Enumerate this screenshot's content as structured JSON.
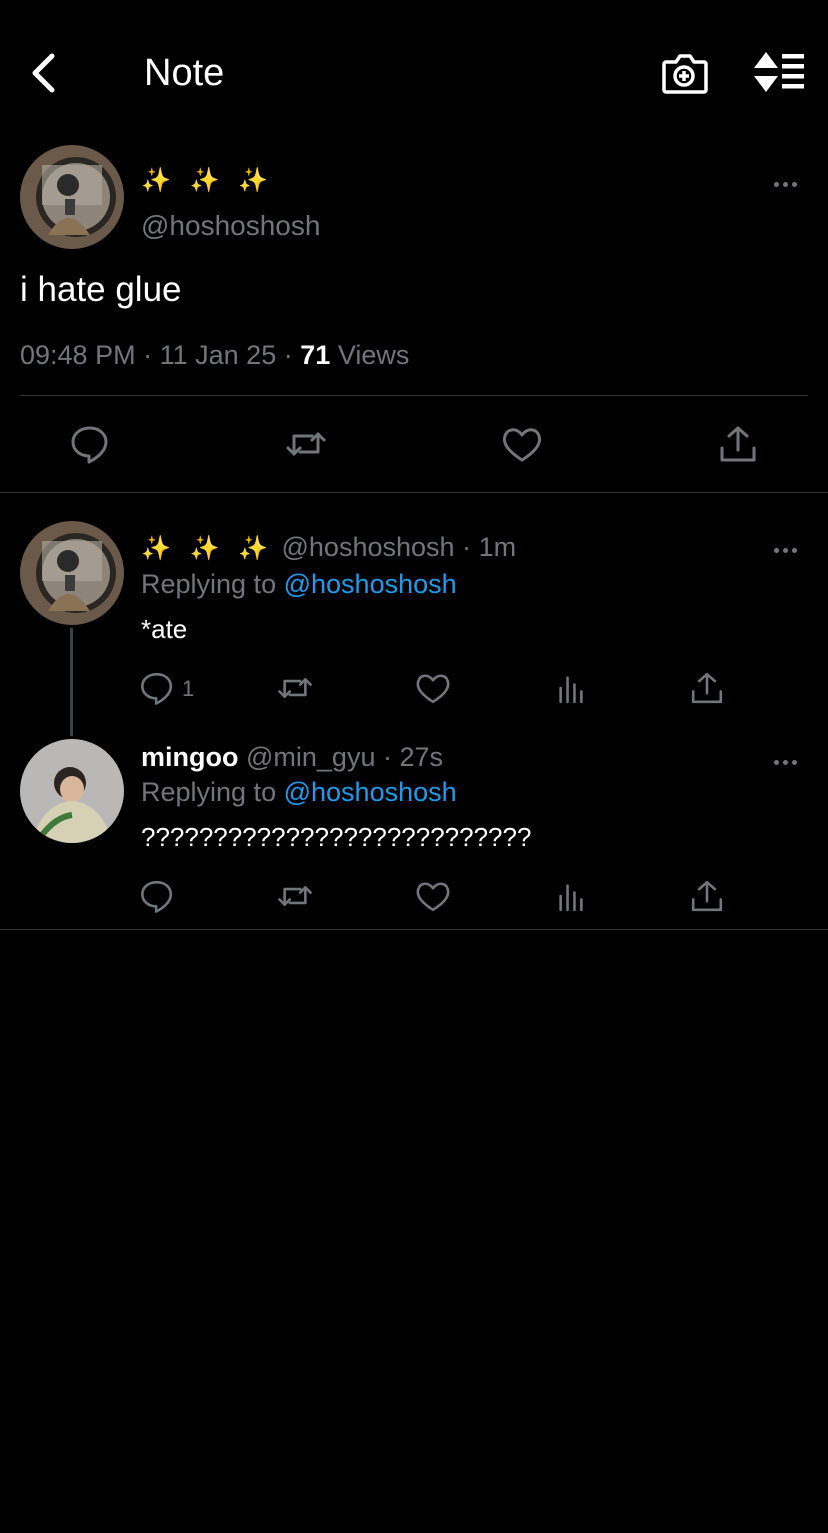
{
  "header": {
    "title": "Note"
  },
  "main_tweet": {
    "display_name": "✨ ✨ ✨",
    "handle": "@hoshoshosh",
    "text": "i hate glue",
    "time": "09:48 PM",
    "date": "11 Jan 25",
    "views_count": "71",
    "views_label": "Views",
    "sep": "·"
  },
  "replies": [
    {
      "display_name": "✨ ✨ ✨",
      "handle": "@hoshoshosh",
      "age": "1m",
      "replying_prefix": "Replying to",
      "replying_handle": "@hoshoshosh",
      "text": "*ate",
      "reply_count": "1"
    },
    {
      "display_name": "mingoo",
      "handle": "@min_gyu",
      "age": "27s",
      "replying_prefix": "Replying to",
      "replying_handle": "@hoshoshosh",
      "text": "???????????????????????????"
    }
  ],
  "colors": {
    "background": "#000000",
    "text": "#e7e9ea",
    "secondary": "#71767b",
    "accent": "#1d9bf0",
    "divider": "#2f3336"
  },
  "icons": [
    "back-arrow-icon",
    "camera-plus-icon",
    "sort-icon",
    "more-icon",
    "reply-icon",
    "retweet-icon",
    "like-icon",
    "analytics-icon",
    "share-icon"
  ]
}
